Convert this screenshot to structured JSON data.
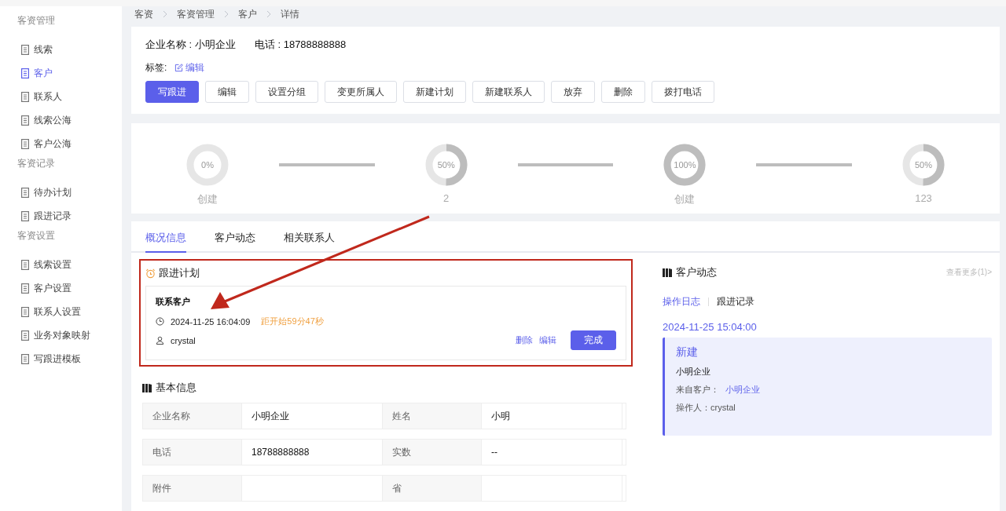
{
  "sidebar": {
    "groups": [
      {
        "title": "客资管理",
        "items": [
          {
            "label": "线索",
            "selected": false
          },
          {
            "label": "客户",
            "selected": true
          },
          {
            "label": "联系人",
            "selected": false
          },
          {
            "label": "线索公海",
            "selected": false
          },
          {
            "label": "客户公海",
            "selected": false
          }
        ]
      },
      {
        "title": "客资记录",
        "items": [
          {
            "label": "待办计划",
            "selected": false
          },
          {
            "label": "跟进记录",
            "selected": false
          }
        ]
      },
      {
        "title": "客资设置",
        "items": [
          {
            "label": "线索设置",
            "selected": false
          },
          {
            "label": "客户设置",
            "selected": false
          },
          {
            "label": "联系人设置",
            "selected": false
          },
          {
            "label": "业务对象映射",
            "selected": false
          },
          {
            "label": "写跟进模板",
            "selected": false
          }
        ]
      }
    ]
  },
  "breadcrumb": [
    "客资",
    "客资管理",
    "客户",
    "详情"
  ],
  "header": {
    "company": "企业名称 : 小明企业",
    "phone": "电话 : 18788888888",
    "tags_label": "标签:",
    "tags_edit": "编辑",
    "buttons": [
      {
        "label": "写跟进",
        "kind": "primary"
      },
      {
        "label": "编辑",
        "kind": "default"
      },
      {
        "label": "设置分组",
        "kind": "default"
      },
      {
        "label": "变更所属人",
        "kind": "default"
      },
      {
        "label": "新建计划",
        "kind": "default"
      },
      {
        "label": "新建联系人",
        "kind": "default"
      },
      {
        "label": "放弃",
        "kind": "default"
      },
      {
        "label": "删除",
        "kind": "default"
      },
      {
        "label": "拨打电话",
        "kind": "default"
      }
    ]
  },
  "steps": [
    {
      "percent": "0%",
      "level": 0,
      "label": "创建"
    },
    {
      "percent": "50%",
      "level": 0.5,
      "label": "2"
    },
    {
      "percent": "100%",
      "level": 1,
      "label": "创建"
    },
    {
      "percent": "50%",
      "level": 0.5,
      "label": "123"
    }
  ],
  "tabs": [
    {
      "label": "概况信息",
      "selected": true
    },
    {
      "label": "客户动态",
      "selected": false
    },
    {
      "label": "相关联系人",
      "selected": false
    }
  ],
  "plan": {
    "title": "跟进计划",
    "task": "联系客户",
    "time": "2024-11-25 16:04:09",
    "countdown": "距开始59分47秒",
    "owner": "crystal",
    "actions": [
      "删除",
      "编辑"
    ],
    "done": "完成"
  },
  "basic_info": {
    "title": "基本信息",
    "rows": [
      [
        "企业名称",
        "小明企业",
        "姓名",
        "小明"
      ],
      [
        "电话",
        "18788888888",
        "实数",
        "--"
      ],
      [
        "附件",
        "",
        "省",
        ""
      ]
    ]
  },
  "activity": {
    "title": "客户动态",
    "more": "查看更多(1)>",
    "subtabs": [
      {
        "label": "操作日志",
        "selected": true
      },
      {
        "label": "跟进记录",
        "selected": false
      }
    ],
    "date": "2024-11-25 15:04:00",
    "entry": {
      "title": "新建",
      "name": "小明企业",
      "from_label": "来自客户：",
      "from_link": "小明企业",
      "operator": "操作人：crystal"
    }
  }
}
